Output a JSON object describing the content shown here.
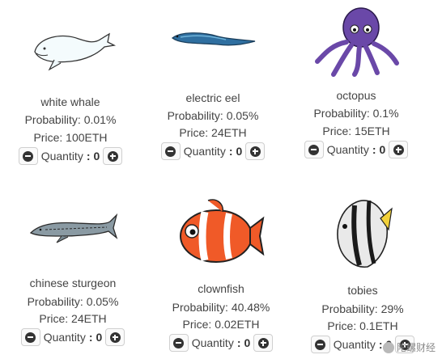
{
  "labels": {
    "probability_prefix": "Probability: ",
    "price_prefix": "Price: ",
    "quantity": "Quantity",
    "separator": ":"
  },
  "items": [
    {
      "name": "white whale",
      "probability": "0.01%",
      "price": "100ETH",
      "quantity": "0"
    },
    {
      "name": "electric eel",
      "probability": "0.05%",
      "price": "24ETH",
      "quantity": "0"
    },
    {
      "name": "octopus",
      "probability": "0.1%",
      "price": "15ETH",
      "quantity": "0"
    },
    {
      "name": "chinese sturgeon",
      "probability": "0.05%",
      "price": "24ETH",
      "quantity": "0"
    },
    {
      "name": "clownfish",
      "probability": "40.48%",
      "price": "0.02ETH",
      "quantity": "0"
    },
    {
      "name": "tobies",
      "probability": "29%",
      "price": "0.1ETH",
      "quantity": "0"
    }
  ],
  "watermark": "陀螺财经",
  "icons": {
    "decrease": "minus-circle-icon",
    "increase": "plus-circle-icon"
  },
  "colors": {
    "text": "#444444",
    "button_border": "#cfcfcf",
    "icon": "#333333"
  }
}
